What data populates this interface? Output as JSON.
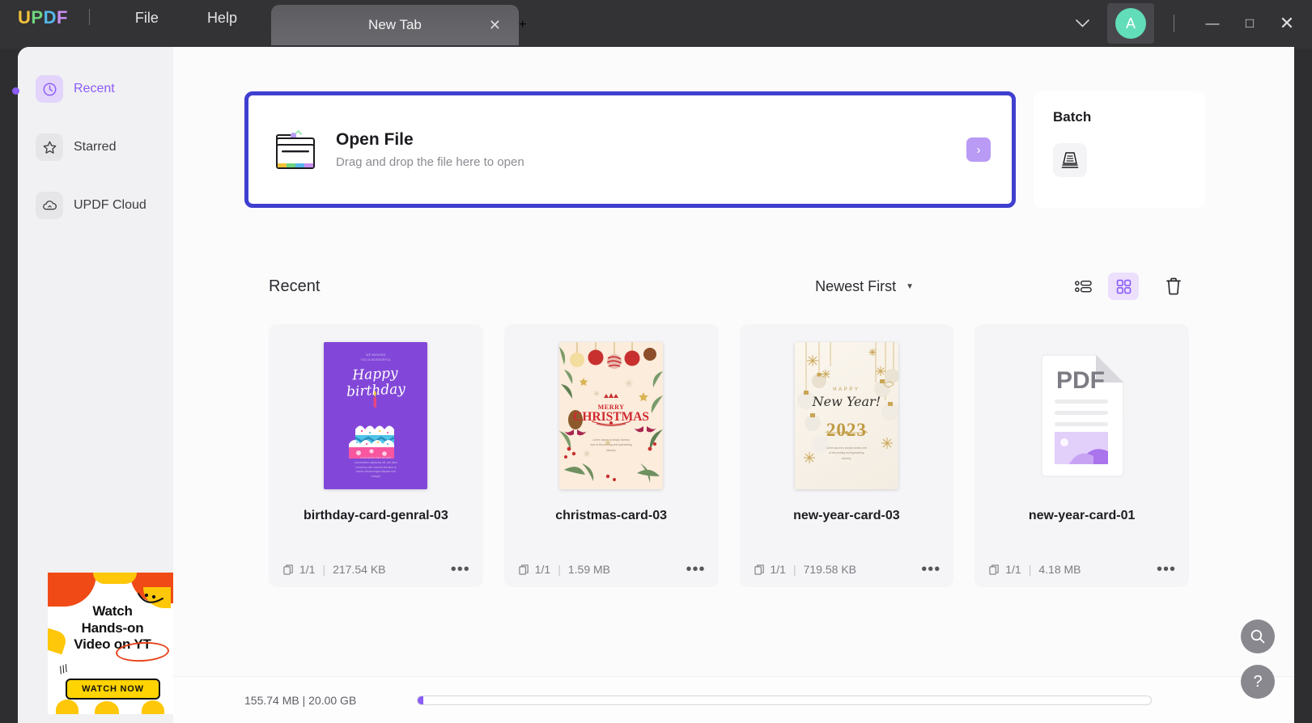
{
  "titlebar": {
    "logo": "UPDF",
    "logo_letters": [
      "U",
      "P",
      "D",
      "F"
    ],
    "menus": [
      "File",
      "Help"
    ],
    "tab_label": "New Tab",
    "tab_close_glyph": "✕",
    "new_tab_glyph": "+",
    "chevron_glyph": "⌄",
    "avatar_initial": "A",
    "minimize_glyph": "—",
    "maximize_glyph": "□",
    "close_glyph": "✕"
  },
  "sidebar": {
    "items": [
      {
        "label": "Recent",
        "icon": "clock-icon",
        "active": true
      },
      {
        "label": "Starred",
        "icon": "star-icon",
        "active": false
      },
      {
        "label": "UPDF Cloud",
        "icon": "cloud-icon",
        "active": false
      }
    ],
    "ad": {
      "line1": "Watch",
      "line2": "Hands-on",
      "line3": "Video on YT",
      "button": "WATCH NOW"
    }
  },
  "open_file": {
    "title": "Open File",
    "subtitle": "Drag and drop the file here to open",
    "arrow_glyph": "›",
    "border_color": "#3f3fcf"
  },
  "batch": {
    "title": "Batch",
    "icon": "stacked-documents-icon"
  },
  "recent": {
    "title": "Recent",
    "sort_label": "Newest First",
    "sort_caret": "▼",
    "view_list_icon": "list-view-icon",
    "view_grid_icon": "grid-view-icon",
    "view_active": "grid",
    "trash_icon": "trash-icon",
    "files": [
      {
        "name": "birthday-card-genral-03",
        "pages": "1/1",
        "size": "217.54 KB",
        "thumb_type": "birthday",
        "thumb_text": {
          "top": "WE WISHING\nYOU A WONDERFUL",
          "headline": "Happy birthday",
          "body": "Lorem ipsum dolor sit amet,\nconsectetuer adipiscing elit, sed diam\nnonummy nibh euismod tincidunt ut\nlaoreet dolore magna aliquam erat\nvolutpat."
        }
      },
      {
        "name": "christmas-card-03",
        "pages": "1/1",
        "size": "1.59 MB",
        "thumb_type": "christmas",
        "thumb_text": {
          "line1": "MERRY",
          "line2": "CHRISTMAS",
          "body": "Lorem Ipsum is simply dummy\ntext of the printing and typesetting\nindustry."
        }
      },
      {
        "name": "new-year-card-03",
        "pages": "1/1",
        "size": "719.58 KB",
        "thumb_type": "newyear",
        "thumb_text": {
          "happy": "HAPPY",
          "script": "New Year!",
          "year": "2023",
          "body": "Lorem ipsum is simply dummy text\nof the printing and typesetting\nindustry."
        }
      },
      {
        "name": "new-year-card-01",
        "pages": "1/1",
        "size": "4.18 MB",
        "thumb_type": "pdf",
        "thumb_text": {
          "label": "PDF"
        }
      }
    ],
    "dots_glyph": "•••"
  },
  "statusbar": {
    "storage": "155.74 MB | 20.00 GB",
    "used_percent": 0.76
  },
  "fabs": [
    {
      "name": "search-fab",
      "icon": "search-icon"
    },
    {
      "name": "help-fab",
      "icon": "question-mark-icon",
      "glyph": "?"
    }
  ],
  "colors": {
    "accent_purple": "#8b5cf6",
    "highlight_border": "#3f3fcf",
    "avatar_teal": "#62ddb9",
    "titlebar_bg": "#333336"
  }
}
